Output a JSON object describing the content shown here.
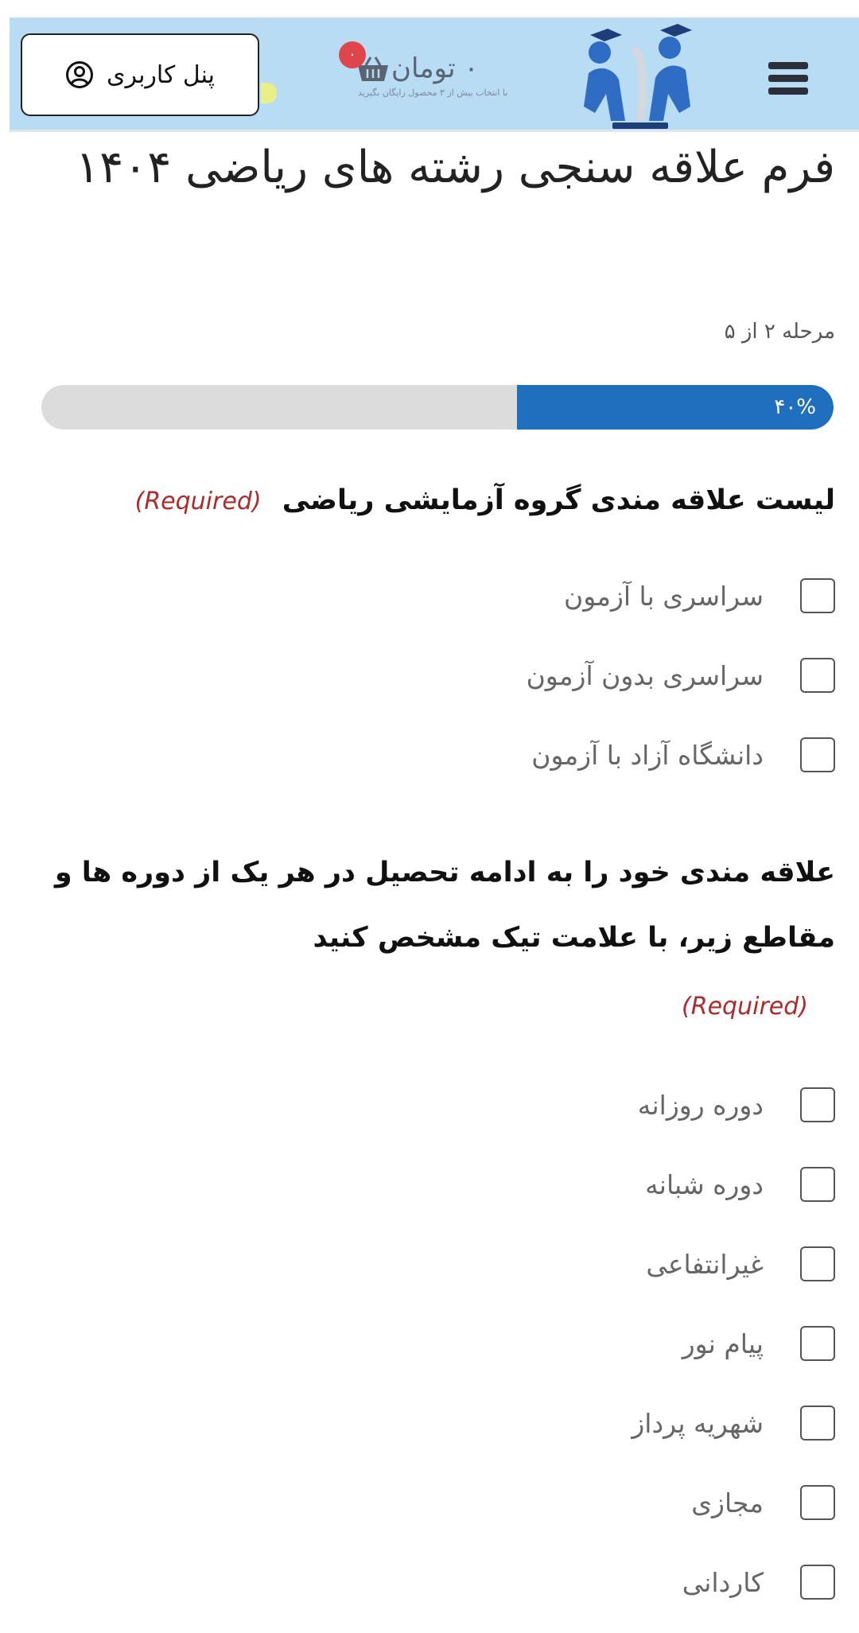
{
  "header": {
    "user_panel_label": "پنل کاربری",
    "cart": {
      "amount": "۰ تومان",
      "badge_count": "۰",
      "subtext": "با انتخاب بیش از ۳ محصول رایگان بگیرید"
    },
    "icons": {
      "menu": "hamburger-menu-icon",
      "cart": "shopping-basket-icon",
      "user": "user-circle-icon",
      "logo": "graduation-logo"
    }
  },
  "form": {
    "title": "فرم علاقه سنجی رشته های ریاضی ۱۴۰۴",
    "step_text": "مرحله ۲ از ۵",
    "progress": {
      "percent": 40,
      "label": "۴۰%"
    },
    "required_label": "(Required)",
    "questions": [
      {
        "label": "لیست علاقه مندی گروه آزمایشی ریاضی",
        "options": [
          "سراسری با آزمون",
          "سراسری بدون آزمون",
          "دانشگاه آزاد با آزمون"
        ]
      },
      {
        "label": "علاقه مندی خود را به ادامه تحصیل در هر یک از دوره ها و مقاطع زیر، با علامت تیک مشخص کنید",
        "options": [
          "دوره روزانه",
          "دوره شبانه",
          "غیرانتفاعی",
          "پیام نور",
          "شهریه پرداز",
          "مجازی",
          "کاردانی"
        ]
      }
    ]
  },
  "colors": {
    "header_bg": "#b7dcf4",
    "progress_fill": "#1f6fbe",
    "progress_track": "#dcdcdc",
    "required": "#b02a2a",
    "badge": "#e0454b"
  }
}
